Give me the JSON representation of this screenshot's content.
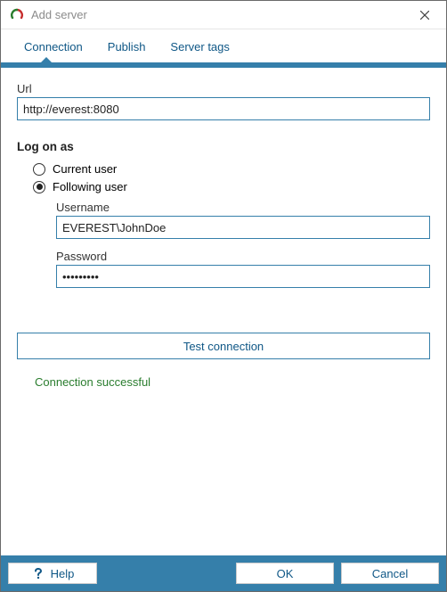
{
  "window": {
    "title": "Add server"
  },
  "tabs": {
    "connection": "Connection",
    "publish": "Publish",
    "server_tags": "Server tags"
  },
  "form": {
    "url_label": "Url",
    "url_value": "http://everest:8080",
    "log_on_as": "Log on as",
    "radio_current_user": "Current user",
    "radio_following_user": "Following user",
    "username_label": "Username",
    "username_value": "EVEREST\\JohnDoe",
    "password_label": "Password",
    "password_value": "•••••••••",
    "test_button": "Test connection",
    "status_message": "Connection successful"
  },
  "footer": {
    "help": "Help",
    "ok": "OK",
    "cancel": "Cancel"
  }
}
